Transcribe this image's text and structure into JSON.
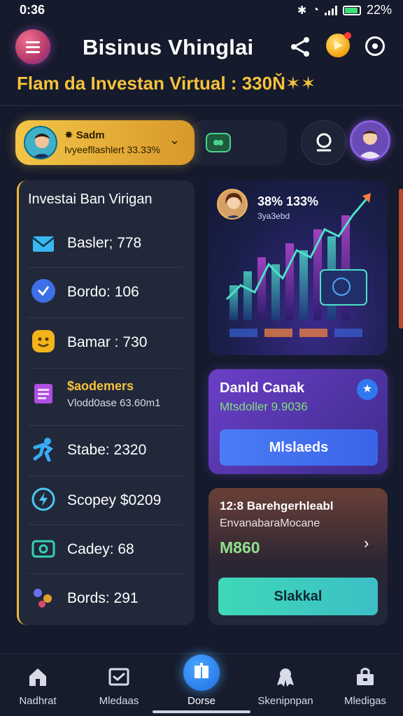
{
  "status_bar": {
    "time": "0:36",
    "battery": "22%"
  },
  "header": {
    "title": "Bisinus Vhinglai",
    "subtitle": "Flam da Investan Virtual : 330Ň✶✶"
  },
  "user": {
    "name": "Sadm",
    "detail": "Ivyeefllashlert 33.33%"
  },
  "list_card": {
    "heading": "Investai Ban Virigan",
    "items": [
      {
        "label": "Basler; 778",
        "icon": "envelope-icon",
        "color": "#3ab6f0"
      },
      {
        "label": "Bordo: 106",
        "icon": "checkmark-badge-icon",
        "color": "#3d6fe8"
      },
      {
        "label": "Bamar : 730",
        "icon": "smiley-badge-icon",
        "color": "#f2b41c"
      },
      {
        "label": "$aodemers",
        "sub": "Vlodd0ase 63.60m1",
        "icon": "clipboard-icon",
        "color": "#b04fe0"
      },
      {
        "label": "Stabe: 2320",
        "icon": "running-figure-icon",
        "color": "#3aaaf5"
      },
      {
        "label": "Scopey $0209",
        "icon": "lightning-circle-icon",
        "color": "#4bc7ef"
      },
      {
        "label": "Cadey: 68",
        "icon": "wallet-icon",
        "color": "#35d0b2"
      },
      {
        "label": "Bords: 291",
        "icon": "people-icon",
        "color": "#6a6ff0"
      }
    ]
  },
  "chart_card": {
    "stat": "38% 133%",
    "sub": "3ya3ebd"
  },
  "promo_card": {
    "title": "Danld Canak",
    "subtitle": "Mtsdoller 9.9036",
    "button": "Mlslaeds"
  },
  "offer_card": {
    "title": "12:8 Barehgerhleabl",
    "subtitle": "EnvanabaraMocane",
    "value": "M860",
    "button": "Slakkal"
  },
  "bottom_nav": [
    {
      "label": "Nadhrat",
      "icon": "home-icon"
    },
    {
      "label": "Mledaas",
      "icon": "message-box-icon"
    },
    {
      "label": "Dorse",
      "icon": "book-icon"
    },
    {
      "label": "Skenipnpan",
      "icon": "award-icon"
    },
    {
      "label": "Mledigas",
      "icon": "bag-icon"
    }
  ]
}
